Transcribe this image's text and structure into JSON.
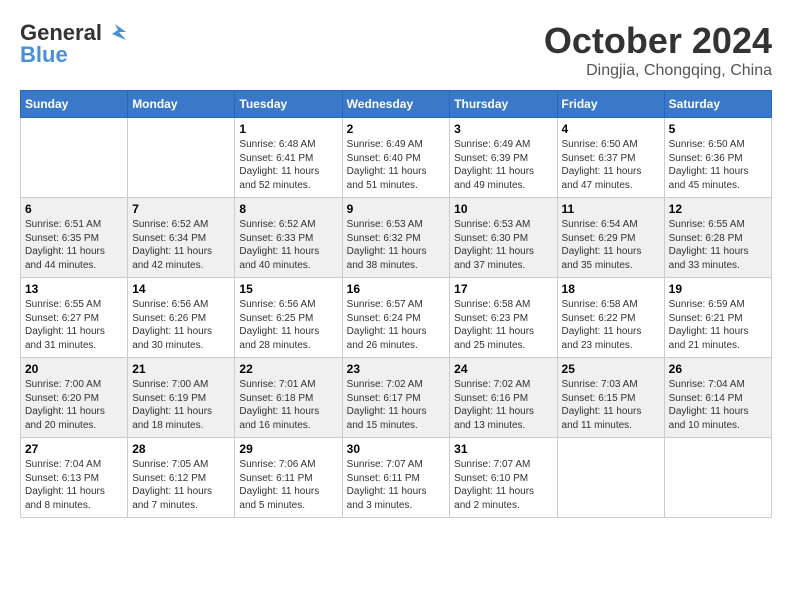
{
  "logo": {
    "general": "General",
    "blue": "Blue"
  },
  "title": {
    "month_year": "October 2024",
    "location": "Dingjia, Chongqing, China"
  },
  "days_of_week": [
    "Sunday",
    "Monday",
    "Tuesday",
    "Wednesday",
    "Thursday",
    "Friday",
    "Saturday"
  ],
  "weeks": [
    [
      {
        "day": "",
        "info": ""
      },
      {
        "day": "",
        "info": ""
      },
      {
        "day": "1",
        "info": "Sunrise: 6:48 AM\nSunset: 6:41 PM\nDaylight: 11 hours and 52 minutes."
      },
      {
        "day": "2",
        "info": "Sunrise: 6:49 AM\nSunset: 6:40 PM\nDaylight: 11 hours and 51 minutes."
      },
      {
        "day": "3",
        "info": "Sunrise: 6:49 AM\nSunset: 6:39 PM\nDaylight: 11 hours and 49 minutes."
      },
      {
        "day": "4",
        "info": "Sunrise: 6:50 AM\nSunset: 6:37 PM\nDaylight: 11 hours and 47 minutes."
      },
      {
        "day": "5",
        "info": "Sunrise: 6:50 AM\nSunset: 6:36 PM\nDaylight: 11 hours and 45 minutes."
      }
    ],
    [
      {
        "day": "6",
        "info": "Sunrise: 6:51 AM\nSunset: 6:35 PM\nDaylight: 11 hours and 44 minutes."
      },
      {
        "day": "7",
        "info": "Sunrise: 6:52 AM\nSunset: 6:34 PM\nDaylight: 11 hours and 42 minutes."
      },
      {
        "day": "8",
        "info": "Sunrise: 6:52 AM\nSunset: 6:33 PM\nDaylight: 11 hours and 40 minutes."
      },
      {
        "day": "9",
        "info": "Sunrise: 6:53 AM\nSunset: 6:32 PM\nDaylight: 11 hours and 38 minutes."
      },
      {
        "day": "10",
        "info": "Sunrise: 6:53 AM\nSunset: 6:30 PM\nDaylight: 11 hours and 37 minutes."
      },
      {
        "day": "11",
        "info": "Sunrise: 6:54 AM\nSunset: 6:29 PM\nDaylight: 11 hours and 35 minutes."
      },
      {
        "day": "12",
        "info": "Sunrise: 6:55 AM\nSunset: 6:28 PM\nDaylight: 11 hours and 33 minutes."
      }
    ],
    [
      {
        "day": "13",
        "info": "Sunrise: 6:55 AM\nSunset: 6:27 PM\nDaylight: 11 hours and 31 minutes."
      },
      {
        "day": "14",
        "info": "Sunrise: 6:56 AM\nSunset: 6:26 PM\nDaylight: 11 hours and 30 minutes."
      },
      {
        "day": "15",
        "info": "Sunrise: 6:56 AM\nSunset: 6:25 PM\nDaylight: 11 hours and 28 minutes."
      },
      {
        "day": "16",
        "info": "Sunrise: 6:57 AM\nSunset: 6:24 PM\nDaylight: 11 hours and 26 minutes."
      },
      {
        "day": "17",
        "info": "Sunrise: 6:58 AM\nSunset: 6:23 PM\nDaylight: 11 hours and 25 minutes."
      },
      {
        "day": "18",
        "info": "Sunrise: 6:58 AM\nSunset: 6:22 PM\nDaylight: 11 hours and 23 minutes."
      },
      {
        "day": "19",
        "info": "Sunrise: 6:59 AM\nSunset: 6:21 PM\nDaylight: 11 hours and 21 minutes."
      }
    ],
    [
      {
        "day": "20",
        "info": "Sunrise: 7:00 AM\nSunset: 6:20 PM\nDaylight: 11 hours and 20 minutes."
      },
      {
        "day": "21",
        "info": "Sunrise: 7:00 AM\nSunset: 6:19 PM\nDaylight: 11 hours and 18 minutes."
      },
      {
        "day": "22",
        "info": "Sunrise: 7:01 AM\nSunset: 6:18 PM\nDaylight: 11 hours and 16 minutes."
      },
      {
        "day": "23",
        "info": "Sunrise: 7:02 AM\nSunset: 6:17 PM\nDaylight: 11 hours and 15 minutes."
      },
      {
        "day": "24",
        "info": "Sunrise: 7:02 AM\nSunset: 6:16 PM\nDaylight: 11 hours and 13 minutes."
      },
      {
        "day": "25",
        "info": "Sunrise: 7:03 AM\nSunset: 6:15 PM\nDaylight: 11 hours and 11 minutes."
      },
      {
        "day": "26",
        "info": "Sunrise: 7:04 AM\nSunset: 6:14 PM\nDaylight: 11 hours and 10 minutes."
      }
    ],
    [
      {
        "day": "27",
        "info": "Sunrise: 7:04 AM\nSunset: 6:13 PM\nDaylight: 11 hours and 8 minutes."
      },
      {
        "day": "28",
        "info": "Sunrise: 7:05 AM\nSunset: 6:12 PM\nDaylight: 11 hours and 7 minutes."
      },
      {
        "day": "29",
        "info": "Sunrise: 7:06 AM\nSunset: 6:11 PM\nDaylight: 11 hours and 5 minutes."
      },
      {
        "day": "30",
        "info": "Sunrise: 7:07 AM\nSunset: 6:11 PM\nDaylight: 11 hours and 3 minutes."
      },
      {
        "day": "31",
        "info": "Sunrise: 7:07 AM\nSunset: 6:10 PM\nDaylight: 11 hours and 2 minutes."
      },
      {
        "day": "",
        "info": ""
      },
      {
        "day": "",
        "info": ""
      }
    ]
  ]
}
